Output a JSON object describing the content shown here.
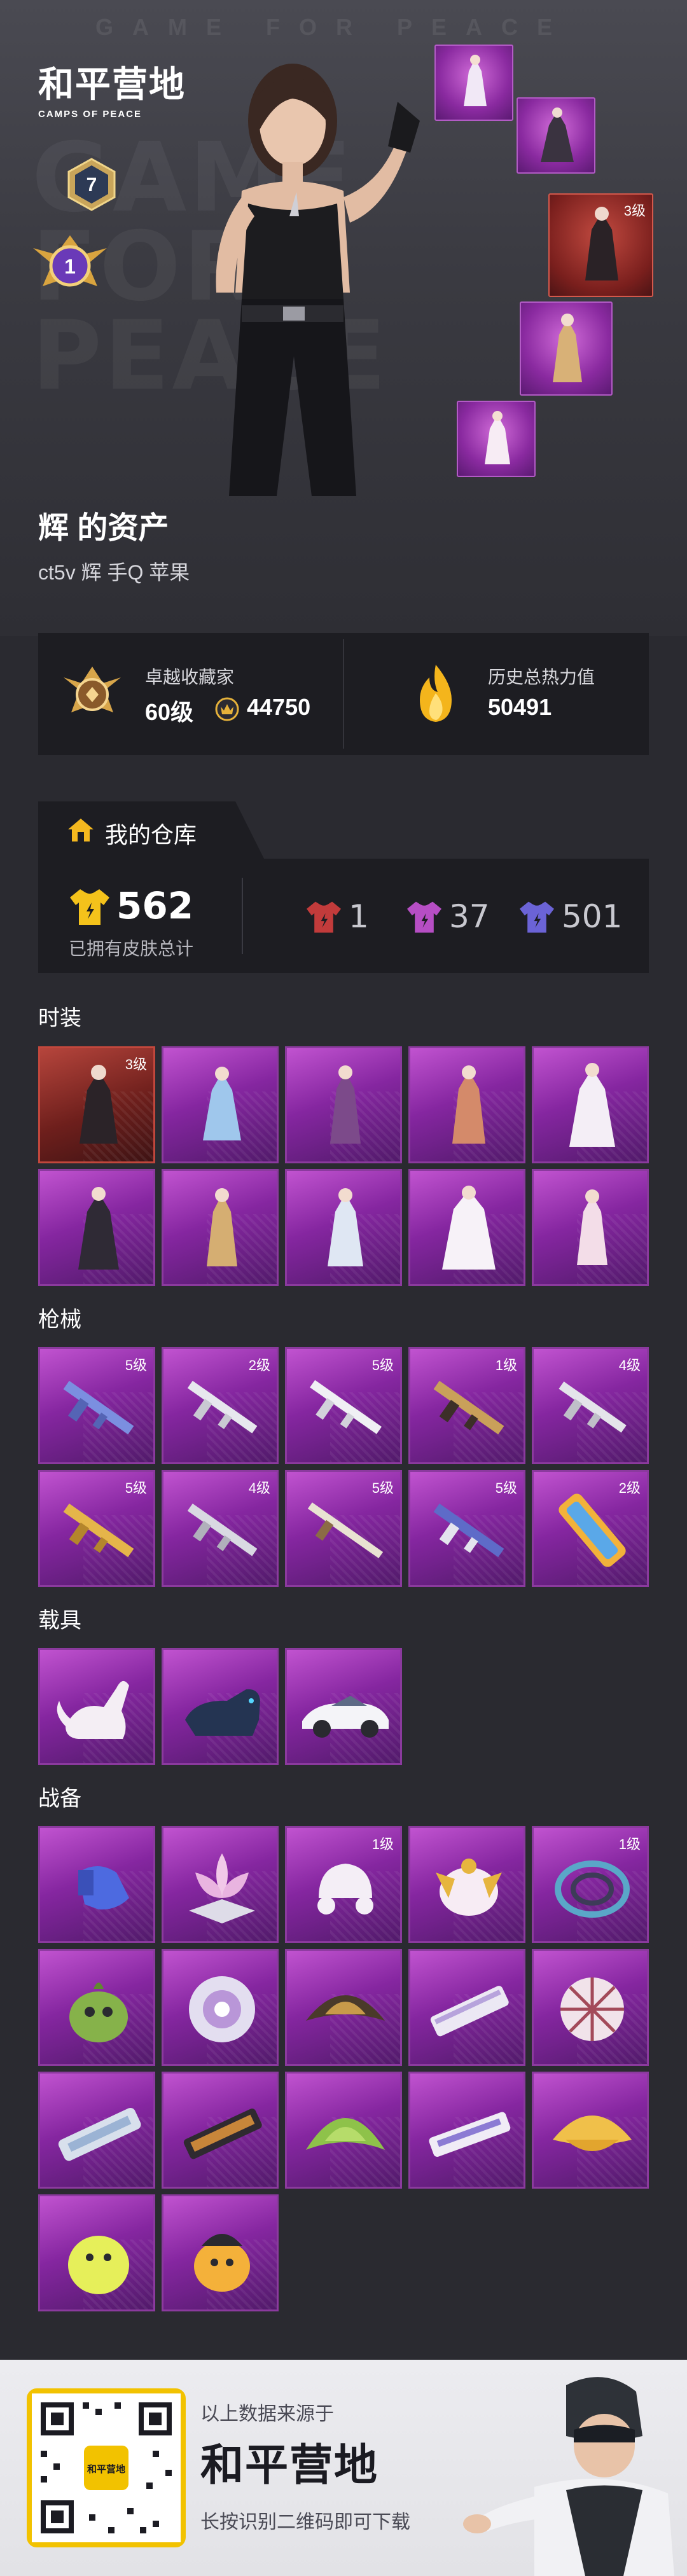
{
  "hero": {
    "bg_top_text": "GAME FOR PEACE",
    "bg_big_text": "GAME FOR PEACE",
    "logo_main": "和平营地",
    "logo_sub": "CAMPS OF PEACE",
    "badge_rank": "7",
    "badge_tier": "1",
    "owner_title": "辉 的资产",
    "owner_sub": "ct5v 辉 手Q 苹果",
    "featured_thumb_level": "3级"
  },
  "stats": {
    "collector_label": "卓越收藏家",
    "collector_level": "60级",
    "collector_points": "44750",
    "heat_label": "历史总热力值",
    "heat_value": "50491"
  },
  "warehouse": {
    "tab_label": "我的仓库",
    "total_skins": "562",
    "total_label": "已拥有皮肤总计",
    "rarity_red": "1",
    "rarity_purple": "37",
    "rarity_blue": "501"
  },
  "sections": {
    "outfits": "时装",
    "guns": "枪械",
    "vehicles": "载具",
    "gear": "战备"
  },
  "outfit_levels": [
    "3级"
  ],
  "gun_levels": [
    "5级",
    "2级",
    "5级",
    "1级",
    "4级",
    "5级",
    "4级",
    "5级",
    "5级",
    "2级"
  ],
  "gear_levels": [
    "1级",
    "1级"
  ],
  "footer": {
    "source_text": "以上数据来源于",
    "logo": "和平营地",
    "hint": "长按识别二维码即可下载",
    "qr_label": "和平营地"
  },
  "colors": {
    "purple_item": "#8526a0",
    "red_item": "#6e1f1c",
    "gold": "#f4c21b",
    "page_bg": "#2a2a30"
  }
}
